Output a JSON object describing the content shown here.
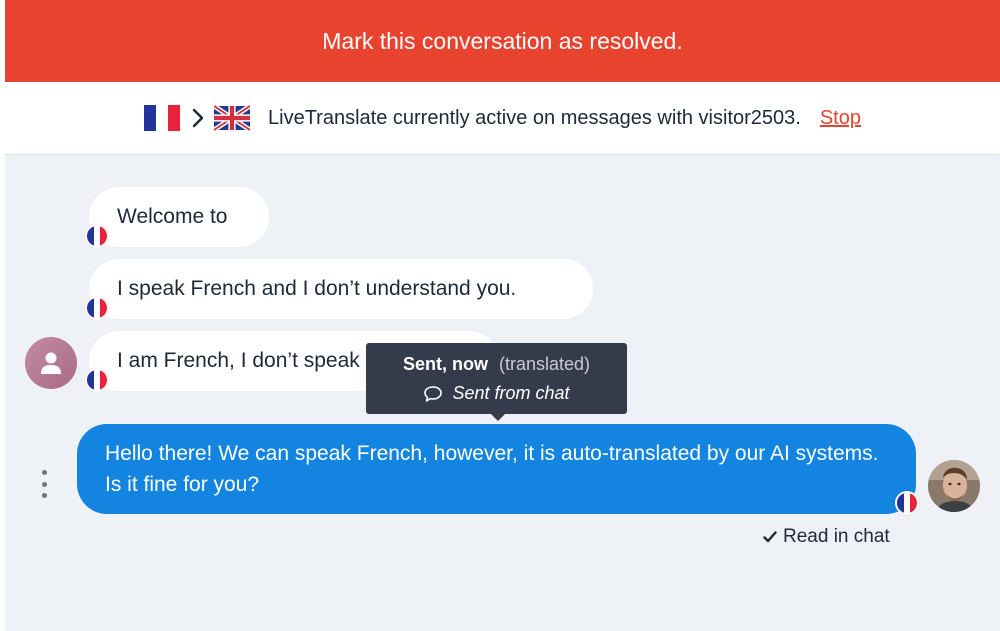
{
  "banner": {
    "resolve_label": "Mark this conversation as resolved."
  },
  "translate_bar": {
    "message": "LiveTranslate currently active on messages with visitor2503.",
    "stop_label": "Stop"
  },
  "messages_in": [
    {
      "text": "Welcome to",
      "language_flag": "france-flag-icon"
    },
    {
      "text": "I speak French and I don’t understand you.",
      "language_flag": "france-flag-icon"
    },
    {
      "text": "I am French, I don’t speak English",
      "language_flag": "france-flag-icon"
    }
  ],
  "tooltip": {
    "sent_label": "Sent, now",
    "translated_label": "(translated)",
    "source_label": "Sent from chat"
  },
  "message_out": {
    "text": "Hello there! We can speak French, however, it is auto-translated by our AI systems. Is it fine for you?",
    "language_flag": "france-flag-icon"
  },
  "read_status": "Read in chat",
  "colors": {
    "banner": "#e8432e",
    "outgoing_bubble": "#1384e0",
    "tooltip": "#343c4b",
    "background": "#eef1f5",
    "link": "#e8432e"
  }
}
